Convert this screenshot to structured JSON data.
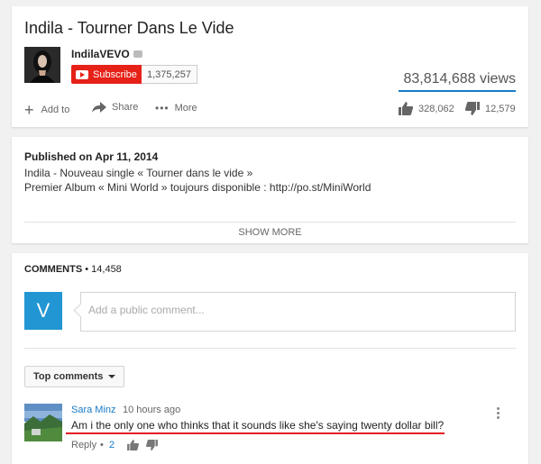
{
  "video": {
    "title": "Indila - Tourner Dans Le Vide",
    "channel_name": "IndilaVEVO",
    "subscribe_label": "Subscribe",
    "subscriber_count": "1,375,257",
    "views": "83,814,688 views",
    "actions": {
      "add_to": "Add to",
      "share": "Share",
      "more": "More"
    },
    "likes": "328,062",
    "dislikes": "12,579"
  },
  "description": {
    "published": "Published on Apr 11, 2014",
    "line1": "Indila - Nouveau single « Tourner dans le vide »",
    "line2": "Premier Album « Mini World » toujours disponible : http://po.st/MiniWorld",
    "show_more": "SHOW MORE"
  },
  "comments": {
    "label": "COMMENTS",
    "separator": "•",
    "count": "14,458",
    "user_initial": "V",
    "placeholder": "Add a public comment...",
    "sort_label": "Top comments",
    "items": [
      {
        "author": "Sara Minz",
        "time": "10 hours ago",
        "text": "Am i the only one who thinks that it sounds like she's saying twenty dollar bill?",
        "reply_label": "Reply",
        "dot": "•",
        "likes": "2"
      }
    ]
  },
  "colors": {
    "subscribe_red": "#e62117",
    "link_blue": "#167ac6",
    "annotation_red": "#e31b23",
    "avatar_blue": "#2196d3"
  }
}
